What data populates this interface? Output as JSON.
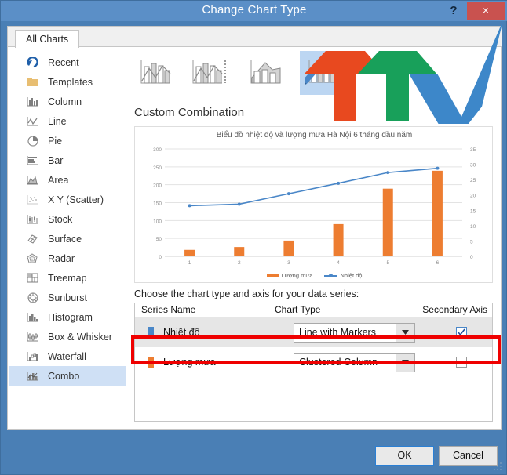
{
  "window": {
    "title": "Change Chart Type",
    "help_label": "?",
    "close_label": "×"
  },
  "tabs": [
    {
      "label": "All Charts",
      "selected": true
    }
  ],
  "sidebar": {
    "items": [
      {
        "label": "Recent",
        "icon": "recent-icon",
        "selected": false
      },
      {
        "label": "Templates",
        "icon": "folder-icon",
        "selected": false
      },
      {
        "label": "Column",
        "icon": "column-chart-icon",
        "selected": false
      },
      {
        "label": "Line",
        "icon": "line-chart-icon",
        "selected": false
      },
      {
        "label": "Pie",
        "icon": "pie-chart-icon",
        "selected": false
      },
      {
        "label": "Bar",
        "icon": "bar-chart-icon",
        "selected": false
      },
      {
        "label": "Area",
        "icon": "area-chart-icon",
        "selected": false
      },
      {
        "label": "X Y (Scatter)",
        "icon": "scatter-chart-icon",
        "selected": false
      },
      {
        "label": "Stock",
        "icon": "stock-chart-icon",
        "selected": false
      },
      {
        "label": "Surface",
        "icon": "surface-chart-icon",
        "selected": false
      },
      {
        "label": "Radar",
        "icon": "radar-chart-icon",
        "selected": false
      },
      {
        "label": "Treemap",
        "icon": "treemap-icon",
        "selected": false
      },
      {
        "label": "Sunburst",
        "icon": "sunburst-icon",
        "selected": false
      },
      {
        "label": "Histogram",
        "icon": "histogram-icon",
        "selected": false
      },
      {
        "label": "Box & Whisker",
        "icon": "box-whisker-icon",
        "selected": false
      },
      {
        "label": "Waterfall",
        "icon": "waterfall-icon",
        "selected": false
      },
      {
        "label": "Combo",
        "icon": "combo-chart-icon",
        "selected": true
      }
    ]
  },
  "gallery": {
    "thumbnails": [
      {
        "name": "clustered-column-line",
        "selected": false
      },
      {
        "name": "clustered-column-line-on-secondary-axis",
        "selected": false
      },
      {
        "name": "stacked-area-clustered-column",
        "selected": false
      },
      {
        "name": "custom-combination",
        "selected": true
      }
    ],
    "heading": "Custom Combination"
  },
  "chart_data": {
    "type": "bar",
    "title": "Biểu đồ nhiệt độ và lượng mưa Hà Nội 6 tháng đầu năm",
    "xlabel": "",
    "ylabel": "",
    "categories": [
      "1",
      "2",
      "3",
      "4",
      "5",
      "6"
    ],
    "grid": true,
    "legend_position": "bottom",
    "left_axis": {
      "ticks": [
        0,
        50,
        100,
        150,
        200,
        250,
        300
      ],
      "ylim": [
        0,
        300
      ]
    },
    "right_axis": {
      "ticks": [
        0,
        5,
        10,
        15,
        20,
        25,
        30,
        35
      ],
      "ylim": [
        0,
        35
      ]
    },
    "series": [
      {
        "name": "Lượng mưa",
        "type": "bar",
        "axis": "primary",
        "color": "#ed7d31",
        "values": [
          18,
          26,
          44,
          90,
          189,
          239
        ]
      },
      {
        "name": "Nhiệt độ",
        "type": "line",
        "axis": "secondary",
        "color": "#4a87c8",
        "markers": true,
        "values": [
          16.5,
          17.0,
          20.4,
          23.8,
          27.3,
          28.7
        ]
      }
    ]
  },
  "series_table": {
    "instruction": "Choose the chart type and axis for your data series:",
    "headers": {
      "series_name": "Series Name",
      "chart_type": "Chart Type",
      "secondary_axis": "Secondary Axis"
    },
    "rows": [
      {
        "series_name": "Nhiệt độ",
        "swatch_color": "#4a87c8",
        "chart_type": "Line with Markers",
        "secondary_axis": true,
        "highlighted": true
      },
      {
        "series_name": "Lượng mưa",
        "swatch_color": "#ed7d31",
        "chart_type": "Clustered Column",
        "secondary_axis": false,
        "highlighted": false
      }
    ]
  },
  "footer": {
    "ok_label": "OK",
    "cancel_label": "Cancel"
  },
  "colors": {
    "titlebar": "#5b8fc7",
    "close": "#c9524f",
    "selection": "#cfe0f5",
    "highlight_box": "#ef0000",
    "series_rain": "#ed7d31",
    "series_temp": "#4a87c8"
  },
  "watermark": {
    "name": "ttv-logo",
    "colors": [
      "#e8491f",
      "#18a05a",
      "#3d87c9"
    ]
  }
}
